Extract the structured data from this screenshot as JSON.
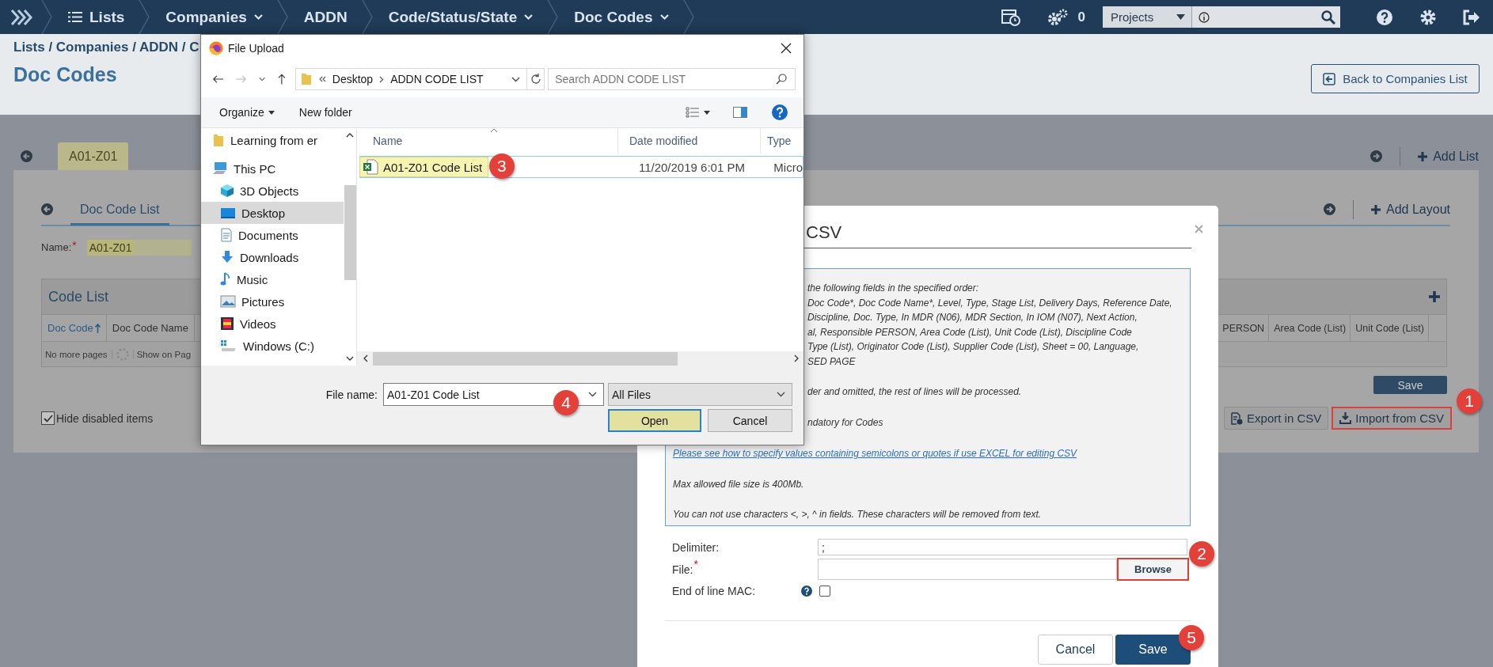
{
  "top_bar": {
    "breadcrumbs": [
      {
        "label": "Lists",
        "kind": "list",
        "dropdown": false
      },
      {
        "label": "Companies",
        "kind": "plain",
        "dropdown": true
      },
      {
        "label": "ADDN",
        "kind": "plain",
        "dropdown": false
      },
      {
        "label": "Code/Status/State",
        "kind": "plain",
        "dropdown": true
      },
      {
        "label": "Doc Codes",
        "kind": "plain",
        "dropdown": true
      }
    ],
    "job_count": "0",
    "project_select": "Projects"
  },
  "page": {
    "path": "Lists / Companies / ADDN / C",
    "title": "Doc Codes",
    "back_button": "Back to Companies List"
  },
  "list_tabs": [
    {
      "label": "A01-Z01",
      "selected": true
    }
  ],
  "add_list": "Add List",
  "layout_tabs": [
    {
      "label": "Doc Code List",
      "selected": true
    }
  ],
  "add_layout": "Add Layout",
  "name_field": {
    "label": "Name:",
    "required_mark": "*",
    "value": "A01-Z01"
  },
  "code_list": {
    "title": "Code List",
    "left_columns": [
      {
        "label": "Doc Code",
        "sorted": true
      },
      {
        "label": "Doc Code Name",
        "sorted": false
      }
    ],
    "right_columns": [
      "PERSON",
      "Area Code (List)",
      "Unit Code (List)"
    ],
    "pager": "No more pages",
    "page_size": "Show on Pag"
  },
  "save_button": "Save",
  "hide_disabled": {
    "label": "Hide disabled items",
    "checked": true
  },
  "csv_buttons": [
    {
      "label": "Export in CSV",
      "kind": "export",
      "highlighted": false
    },
    {
      "label": "Import from CSV",
      "kind": "import",
      "highlighted": true,
      "step": "1"
    }
  ],
  "import_modal": {
    "title": "CSV",
    "instruction_paragraphs": [
      [
        "the following fields in the specified order:",
        "Doc Code*, Doc Code Name*, Level, Type, Stage List, Delivery Days, Reference Date,",
        "Discipline, Doc. Type, In MDR (N06), MDR Section, In IOM (N07), Next Action,",
        "al, Responsible PERSON, Area Code (List), Unit Code (List), Discipline Code",
        "Type (List), Originator Code (List), Supplier Code (List), Sheet = 00, Language,",
        "SED PAGE"
      ],
      [
        "der and omitted, the rest of lines will be processed."
      ],
      [
        "ndatory for Codes"
      ]
    ],
    "link": "Please see how to specify values containing semicolons or quotes if use EXCEL for editing CSV",
    "notes": [
      "Max allowed file size is 400Mb.",
      "You can not use characters <, >, ^ in fields. These characters will be removed from text."
    ],
    "fields": [
      {
        "kind": "text",
        "label": "Delimiter:",
        "value": ";"
      },
      {
        "kind": "file",
        "label": "File:",
        "required_mark": "*",
        "button": "Browse",
        "highlighted": true,
        "step": "2"
      },
      {
        "kind": "checkbox",
        "label": "End of line MAC:",
        "checked": false
      }
    ],
    "buttons": [
      {
        "label": "Cancel",
        "kind": "secondary"
      },
      {
        "label": "Save",
        "kind": "primary",
        "step": "5"
      }
    ]
  },
  "file_dialog": {
    "title": "File Upload",
    "path": [
      "Desktop",
      "ADDN CODE LIST"
    ],
    "search_placeholder": "Search ADDN CODE LIST",
    "toolbar": [
      "Organize",
      "New folder"
    ],
    "nav": [
      {
        "label": "Learning from er",
        "kind": "folder",
        "selected": false
      },
      {
        "label": "This PC",
        "kind": "pc",
        "selected": false,
        "children": [
          {
            "label": "3D Objects",
            "kind": "cube",
            "selected": false
          },
          {
            "label": "Desktop",
            "kind": "desktop",
            "selected": true
          },
          {
            "label": "Documents",
            "kind": "documents",
            "selected": false
          },
          {
            "label": "Downloads",
            "kind": "downloads",
            "selected": false
          },
          {
            "label": "Music",
            "kind": "music",
            "selected": false
          },
          {
            "label": "Pictures",
            "kind": "pictures",
            "selected": false
          },
          {
            "label": "Videos",
            "kind": "videos",
            "selected": false
          },
          {
            "label": "Windows (C:)",
            "kind": "drive",
            "selected": false
          }
        ]
      }
    ],
    "columns": [
      "Name",
      "Date modified",
      "Type"
    ],
    "files": [
      {
        "name": "A01-Z01 Code List",
        "date": "11/20/2019 6:01 PM",
        "type": "Micro",
        "selected": true,
        "step": "3"
      }
    ],
    "file_name_label": "File name:",
    "file_name": "A01-Z01 Code List",
    "filter": "All Files",
    "buttons": [
      {
        "label": "Open",
        "kind": "primary",
        "step": "4"
      },
      {
        "label": "Cancel",
        "kind": "secondary"
      }
    ]
  }
}
